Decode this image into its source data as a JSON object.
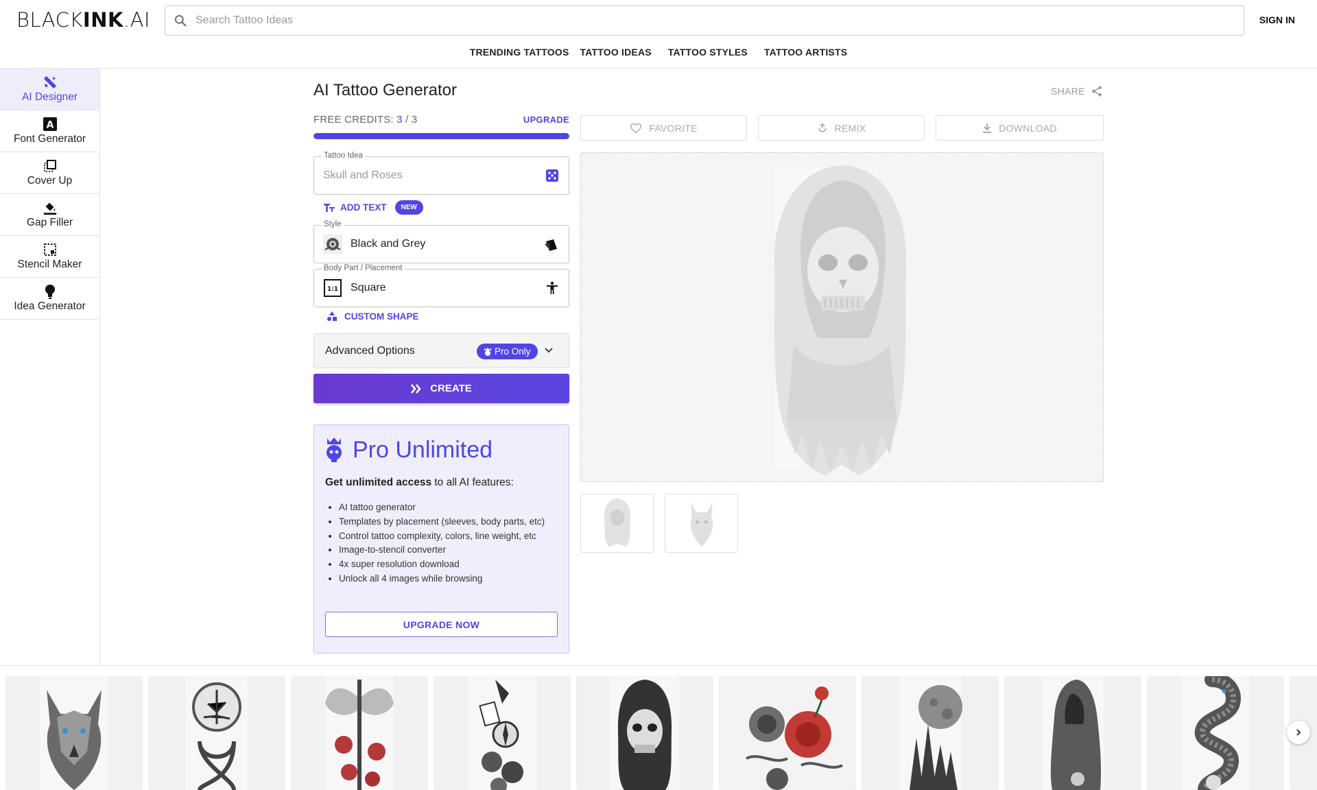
{
  "header": {
    "logo_light": "BLACK",
    "logo_bold": "INK",
    "logo_suffix": ".AI",
    "search_placeholder": "Search Tattoo Ideas",
    "signin_label": "SIGN IN"
  },
  "nav": {
    "items": [
      "TRENDING TATTOOS",
      "TATTOO IDEAS",
      "TATTOO STYLES",
      "TATTOO ARTISTS"
    ]
  },
  "sidebar": {
    "items": [
      {
        "label": "AI Designer",
        "icon": "ai-designer-icon",
        "active": true
      },
      {
        "label": "Font Generator",
        "icon": "font-icon"
      },
      {
        "label": "Cover Up",
        "icon": "cover-up-icon"
      },
      {
        "label": "Gap Filler",
        "icon": "paint-bucket-icon"
      },
      {
        "label": "Stencil Maker",
        "icon": "stencil-icon"
      },
      {
        "label": "Idea Generator",
        "icon": "lightbulb-icon"
      }
    ]
  },
  "main": {
    "title": "AI Tattoo Generator",
    "share_label": "SHARE",
    "credits": {
      "label": "FREE CREDITS:",
      "used": "3",
      "separator": "/",
      "total": "3",
      "progress": 1.0
    },
    "upgrade_label": "UPGRADE",
    "tattoo_idea": {
      "label": "Tattoo Idea",
      "placeholder": "Skull and Roses"
    },
    "add_text": {
      "label": "ADD TEXT",
      "badge": "NEW"
    },
    "style": {
      "label": "Style",
      "value": "Black and Grey"
    },
    "placement": {
      "label": "Body Part / Placement",
      "value": "Square",
      "thumb_text": "1:1"
    },
    "custom_shape_label": "CUSTOM SHAPE",
    "advanced": {
      "label": "Advanced Options",
      "badge": "Pro Only"
    },
    "create_label": "CREATE",
    "pro_box": {
      "title": "Pro Unlimited",
      "sub_bold": "Get unlimited access",
      "sub_rest": " to all AI features:",
      "features": [
        "AI tattoo generator",
        "Templates by placement (sleeves, body parts, etc)",
        "Control tattoo complexity, colors, line weight, etc",
        "Image-to-stencil converter",
        "4x super resolution download",
        "Unlock all 4 images while browsing"
      ],
      "button_label": "UPGRADE NOW"
    }
  },
  "preview": {
    "actions": [
      "FAVORITE",
      "REMIX",
      "DOWNLOAD"
    ]
  },
  "colors": {
    "accent": "#4f46e5",
    "active_bg": "#eeeefb",
    "pro_bg": "#f0eefc"
  }
}
